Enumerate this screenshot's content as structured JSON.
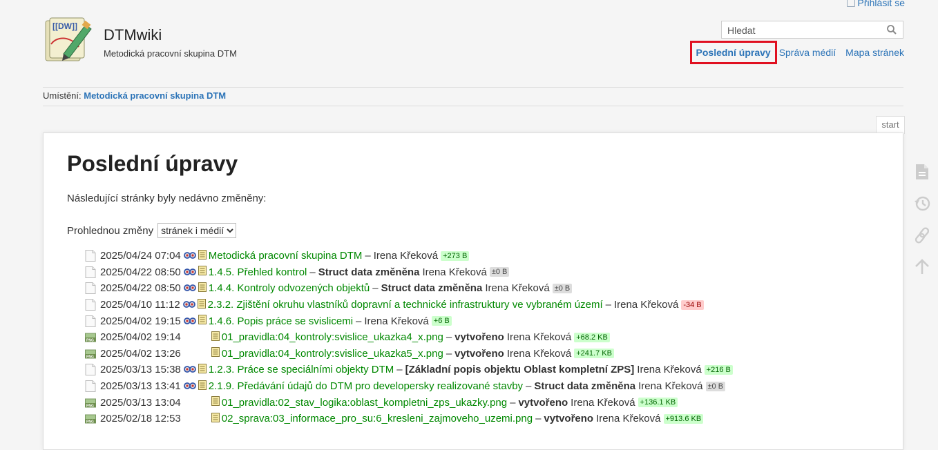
{
  "header": {
    "login_label": "Přihlásit se",
    "site_title": "DTMwiki",
    "tagline": "Metodická pracovní skupina DTM",
    "search_placeholder": "Hledat",
    "usertools": {
      "recent": "Poslední úpravy",
      "media": "Správa médií",
      "sitemap": "Mapa stránek"
    }
  },
  "breadcrumb": {
    "label": "Umístění:",
    "page": "Metodická pracovní skupina DTM"
  },
  "page_id": "start",
  "content": {
    "heading": "Poslední úpravy",
    "intro": "Následující stránky byly nedávno změněny:",
    "filter_label": "Prohlednou změny",
    "filter_value": "stránek i médií"
  },
  "changes": [
    {
      "type": "page",
      "date": "2025/04/24 07:04",
      "title": "Metodická pracovní skupina DTM",
      "summary": "",
      "user": "Irena Křeková",
      "delta": "+273 B",
      "delta_kind": "pos"
    },
    {
      "type": "page",
      "date": "2025/04/22 08:50",
      "title": "1.4.5. Přehled kontrol",
      "summary": "Struct data změněna",
      "user": "Irena Křeková",
      "delta": "±0 B",
      "delta_kind": "neu"
    },
    {
      "type": "page",
      "date": "2025/04/22 08:50",
      "title": "1.4.4. Kontroly odvozených objektů",
      "summary": "Struct data změněna",
      "user": "Irena Křeková",
      "delta": "±0 B",
      "delta_kind": "neu"
    },
    {
      "type": "page",
      "date": "2025/04/10 11:12",
      "title": "2.3.2. Zjištění okruhu vlastníků dopravní a technické infrastruktury ve vybraném území",
      "summary": "",
      "user": "Irena Křeková",
      "delta": "-34 B",
      "delta_kind": "neg"
    },
    {
      "type": "page",
      "date": "2025/04/02 19:15",
      "title": "1.4.6. Popis práce se svislicemi",
      "summary": "",
      "user": "Irena Křeková",
      "delta": "+6 B",
      "delta_kind": "pos"
    },
    {
      "type": "media",
      "date": "2025/04/02 19:14",
      "title": "01_pravidla:04_kontroly:svislice_ukazka4_x.png",
      "summary": "vytvořeno",
      "user": "Irena Křeková",
      "delta": "+68.2 KB",
      "delta_kind": "pos"
    },
    {
      "type": "media",
      "date": "2025/04/02 13:26",
      "title": "01_pravidla:04_kontroly:svislice_ukazka5_x.png",
      "summary": "vytvořeno",
      "user": "Irena Křeková",
      "delta": "+241.7 KB",
      "delta_kind": "pos"
    },
    {
      "type": "page",
      "date": "2025/03/13 15:38",
      "title": "1.2.3. Práce se speciálními objekty DTM",
      "summary": "[Základní popis objektu Oblast kompletní ZPS]",
      "user": "Irena Křeková",
      "delta": "+216 B",
      "delta_kind": "pos"
    },
    {
      "type": "page",
      "date": "2025/03/13 13:41",
      "title": "2.1.9. Předávání údajů do DTM pro developersky realizované stavby",
      "summary": "Struct data změněna",
      "user": "Irena Křeková",
      "delta": "±0 B",
      "delta_kind": "neu"
    },
    {
      "type": "media",
      "date": "2025/03/13 13:04",
      "title": "01_pravidla:02_stav_logika:oblast_kompletni_zps_ukazky.png",
      "summary": "vytvořeno",
      "user": "Irena Křeková",
      "delta": "+136.1 KB",
      "delta_kind": "pos"
    },
    {
      "type": "media",
      "date": "2025/02/18 12:53",
      "title": "02_sprava:03_informace_pro_su:6_kresleni_zajmoveho_uzemi.png",
      "summary": "vytvořeno",
      "user": "Irena Křeková",
      "delta": "+913.6 KB",
      "delta_kind": "pos"
    }
  ],
  "pagetools": [
    "page-icon",
    "history-icon",
    "link-icon",
    "back-to-top-icon"
  ],
  "colors": {
    "link": "#2b73b7",
    "page_link": "#008800",
    "highlight": "#e01020"
  }
}
